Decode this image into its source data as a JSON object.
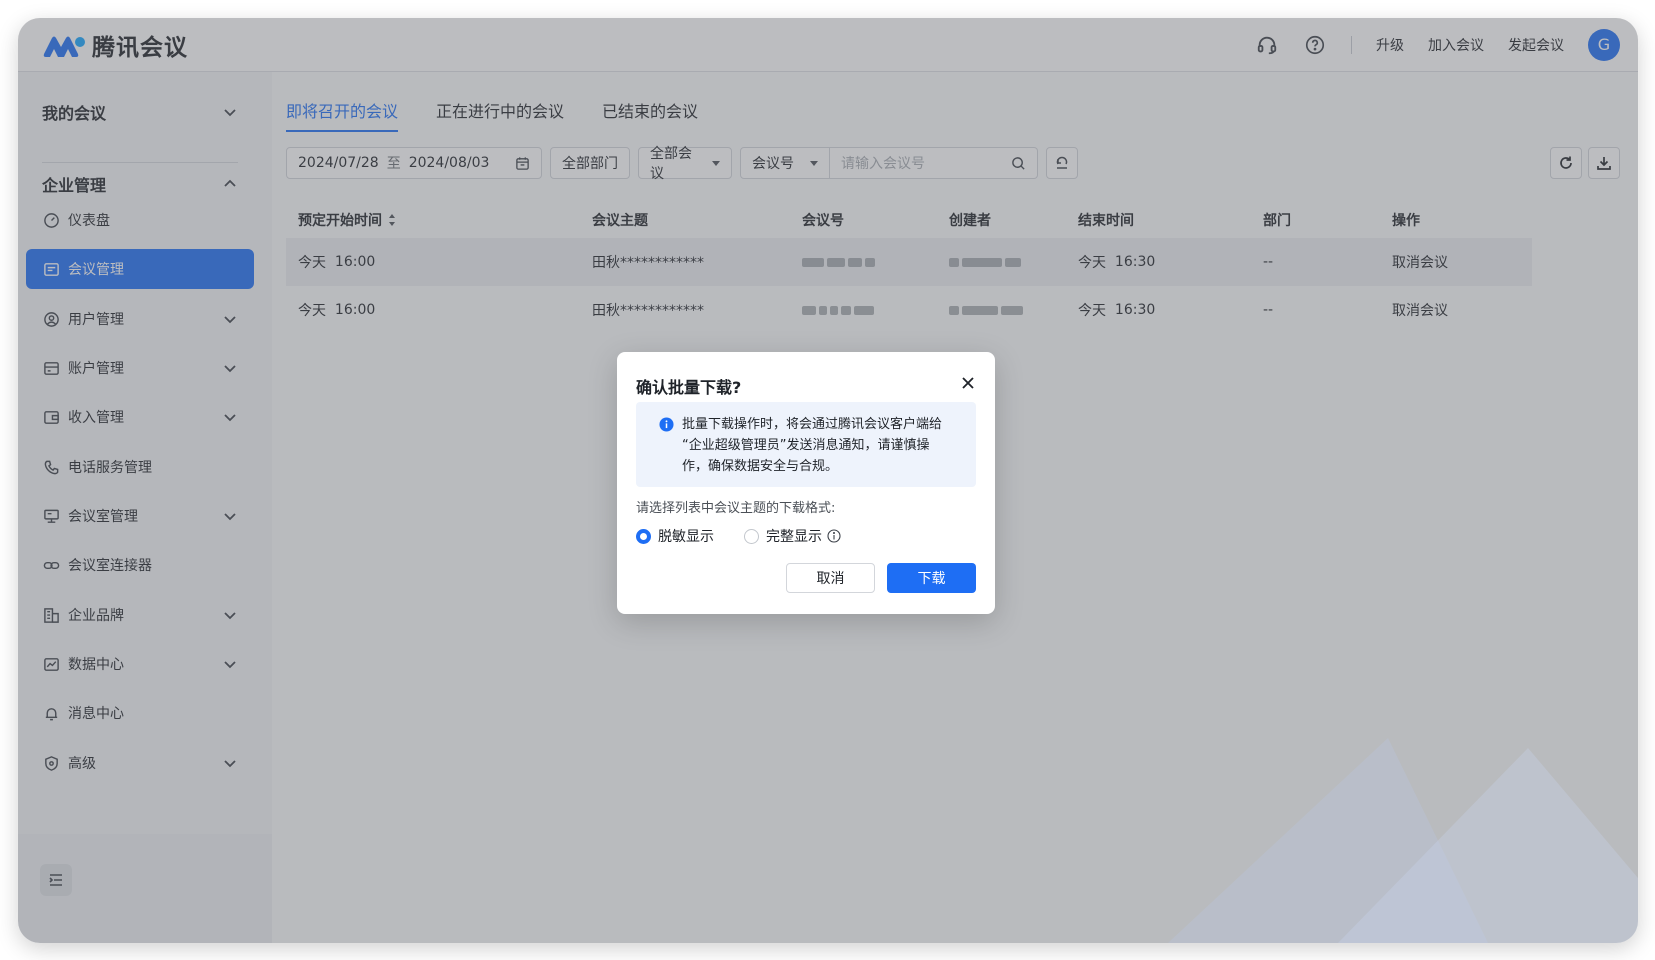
{
  "app": {
    "name": "腾讯会议",
    "brand_color": "#1e6ef4"
  },
  "header": {
    "icons": [
      "headset-icon",
      "help-circle-icon"
    ],
    "links": {
      "upgrade": "升级",
      "join": "加入会议",
      "start": "发起会议"
    },
    "avatar_letter": "G"
  },
  "sidebar": {
    "my_meetings": "我的会议",
    "enterprise": "企业管理",
    "items": [
      {
        "label": "仪表盘",
        "icon": "dashboard-icon",
        "has_chevron": false,
        "active": false
      },
      {
        "label": "会议管理",
        "icon": "meeting-list-icon",
        "has_chevron": false,
        "active": true
      },
      {
        "label": "用户管理",
        "icon": "user-circle-icon",
        "has_chevron": true,
        "active": false
      },
      {
        "label": "账户管理",
        "icon": "account-card-icon",
        "has_chevron": true,
        "active": false
      },
      {
        "label": "收入管理",
        "icon": "wallet-icon",
        "has_chevron": true,
        "active": false
      },
      {
        "label": "电话服务管理",
        "icon": "phone-icon",
        "has_chevron": false,
        "active": false
      },
      {
        "label": "会议室管理",
        "icon": "room-screen-icon",
        "has_chevron": true,
        "active": false
      },
      {
        "label": "会议室连接器",
        "icon": "link-icon",
        "has_chevron": false,
        "active": false
      },
      {
        "label": "企业品牌",
        "icon": "building-icon",
        "has_chevron": true,
        "active": false
      },
      {
        "label": "数据中心",
        "icon": "chart-icon",
        "has_chevron": true,
        "active": false
      },
      {
        "label": "消息中心",
        "icon": "bell-icon",
        "has_chevron": false,
        "active": false
      },
      {
        "label": "高级",
        "icon": "shield-icon",
        "has_chevron": true,
        "active": false
      }
    ]
  },
  "main": {
    "tabs": [
      {
        "label": "即将召开的会议",
        "active": true
      },
      {
        "label": "正在进行中的会议",
        "active": false
      },
      {
        "label": "已结束的会议",
        "active": false
      }
    ],
    "filters": {
      "date_start": "2024/07/28",
      "date_sep": "至",
      "date_end": "2024/08/03",
      "department": "全部部门",
      "meeting_type": "全部会议",
      "search_field": "会议号",
      "search_placeholder": "请输入会议号"
    },
    "table": {
      "columns": [
        "预定开始时间",
        "会议主题",
        "会议号",
        "创建者",
        "结束时间",
        "部门",
        "操作"
      ],
      "rows": [
        {
          "start_day": "今天",
          "start_time": "16:00",
          "topic": "田秋************",
          "end_day": "今天",
          "end_time": "16:30",
          "dept": "--",
          "action": "取消会议"
        },
        {
          "start_day": "今天",
          "start_time": "16:00",
          "topic": "田秋************",
          "end_day": "今天",
          "end_time": "16:30",
          "dept": "--",
          "action": "取消会议"
        }
      ]
    }
  },
  "dialog": {
    "title": "确认批量下载?",
    "notice_line1": "批量下载操作时，将会通过腾讯会议客户端给",
    "notice_line2": "“企业超级管理员”发送消息通知，请谨慎操",
    "notice_line3": "作，确保数据安全与合规。",
    "format_label": "请选择列表中会议主题的下载格式:",
    "option_masked": "脱敏显示",
    "option_full": "完整显示",
    "selected": "masked",
    "cancel": "取消",
    "confirm": "下载"
  }
}
